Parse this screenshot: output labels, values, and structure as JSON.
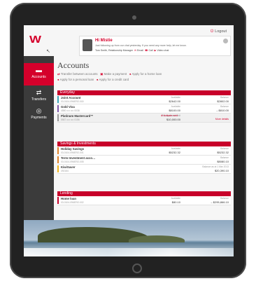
{
  "brand": {
    "logo_text": "W",
    "accent": "#d5002b"
  },
  "header": {
    "logout_label": "Logout"
  },
  "sidebar": {
    "items": [
      {
        "label": "Accounts",
        "icon": "accounts-icon"
      },
      {
        "label": "Transfers",
        "icon": "transfer-icon"
      },
      {
        "label": "Payments",
        "icon": "payments-icon"
      }
    ]
  },
  "message": {
    "title": "Hi Mistie",
    "body": "Just following up from our chat yesterday. If you need any more help, let me know.",
    "sender": "Tom Smith, Relationship Manager",
    "actions": [
      "Email",
      "Call",
      "Video chat"
    ]
  },
  "page": {
    "title": "Accounts",
    "links": [
      "Transfer between accounts",
      "Make a payment",
      "Apply for a home loan",
      "Apply for a personal loan",
      "Apply for a credit card"
    ]
  },
  "sections": [
    {
      "title": "Everyday",
      "accounts": [
        {
          "name": "Joint Account",
          "number": "03-0104-0968792-000",
          "label1": "Available",
          "value1": "$2642.00",
          "label2": "Balance",
          "value2": "$2802.00",
          "color": "#3aa6b9"
        },
        {
          "name": "Gold Visa",
          "number": "4550 •••• •••• 0038",
          "label1": "Available",
          "value1": "$8100.00",
          "label2": "Balance",
          "value2": "– $810.00",
          "color": "#7e57a8"
        },
        {
          "name": "Platinum Mastercard™",
          "number": "5567 •••• •••• 0156",
          "label1": "Pre-approved limit",
          "value1": "$10,000.00",
          "warning": "Activate card",
          "warning2": "More details",
          "color": "#999999"
        }
      ]
    },
    {
      "title": "Savings & Investments",
      "accounts": [
        {
          "name": "Holiday Savings",
          "number": "03-0104-0968792-001",
          "label1": "Available",
          "value1": "$5232.32",
          "label2": "Balance",
          "value2": "$5232.32",
          "color": "#e0832a"
        },
        {
          "name": "Term Investment acco…",
          "number": "03-0104-0968792-005",
          "label1": "",
          "value1": "",
          "label2": "Balance",
          "value2": "$8080.10",
          "color": "#e0832a"
        },
        {
          "name": "KiwiSaver",
          "number": "492164",
          "label1": "",
          "value1": "",
          "label2": "Balance as at 1 Mar 2013",
          "value2": "$20,390.10",
          "color": "#f2b51e"
        }
      ]
    },
    {
      "title": "Lending",
      "accounts": [
        {
          "name": "Home loan",
          "number": "03-0104-0968792-002",
          "label1": "Available",
          "value1": "$80.10",
          "label2": "Balance",
          "value2": "– $295,866.10",
          "color": "#c8002a"
        }
      ]
    }
  ]
}
